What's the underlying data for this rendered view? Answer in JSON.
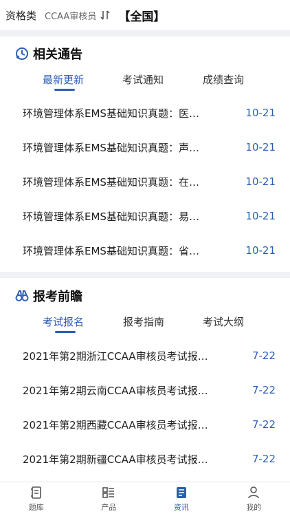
{
  "header": {
    "category": "资格类",
    "exam": "CCAA审核员",
    "switch_icon": "swap-icon",
    "region": "【全国】"
  },
  "notices": {
    "title": "相关通告",
    "icon": "notice-icon",
    "tabs": [
      {
        "label": "最新更新",
        "active": true
      },
      {
        "label": "考试通知",
        "active": false
      },
      {
        "label": "成绩查询",
        "active": false
      }
    ],
    "items": [
      {
        "title": "环境管理体系EMS基础知识真题：医…",
        "date": "10-21"
      },
      {
        "title": "环境管理体系EMS基础知识真题：声…",
        "date": "10-21"
      },
      {
        "title": "环境管理体系EMS基础知识真题：在…",
        "date": "10-21"
      },
      {
        "title": "环境管理体系EMS基础知识真题：易…",
        "date": "10-21"
      },
      {
        "title": "环境管理体系EMS基础知识真题：省…",
        "date": "10-21"
      }
    ]
  },
  "preview": {
    "title": "报考前瞻",
    "icon": "binoculars-icon",
    "tabs": [
      {
        "label": "考试报名",
        "active": true
      },
      {
        "label": "报考指南",
        "active": false
      },
      {
        "label": "考试大纲",
        "active": false
      }
    ],
    "items": [
      {
        "title": "2021年第2期浙江CCAA审核员考试报…",
        "date": "7-22"
      },
      {
        "title": "2021年第2期云南CCAA审核员考试报…",
        "date": "7-22"
      },
      {
        "title": "2021年第2期西藏CCAA审核员考试报…",
        "date": "7-22"
      },
      {
        "title": "2021年第2期新疆CCAA审核员考试报…",
        "date": "7-22"
      }
    ]
  },
  "nav": [
    {
      "label": "题库",
      "icon": "question-bank-icon",
      "active": false
    },
    {
      "label": "产品",
      "icon": "products-icon",
      "active": false
    },
    {
      "label": "资讯",
      "icon": "news-icon",
      "active": true
    },
    {
      "label": "我的",
      "icon": "profile-icon",
      "active": false
    }
  ],
  "colors": {
    "accent": "#2b5fb4",
    "divider": "#f0f1f5"
  }
}
